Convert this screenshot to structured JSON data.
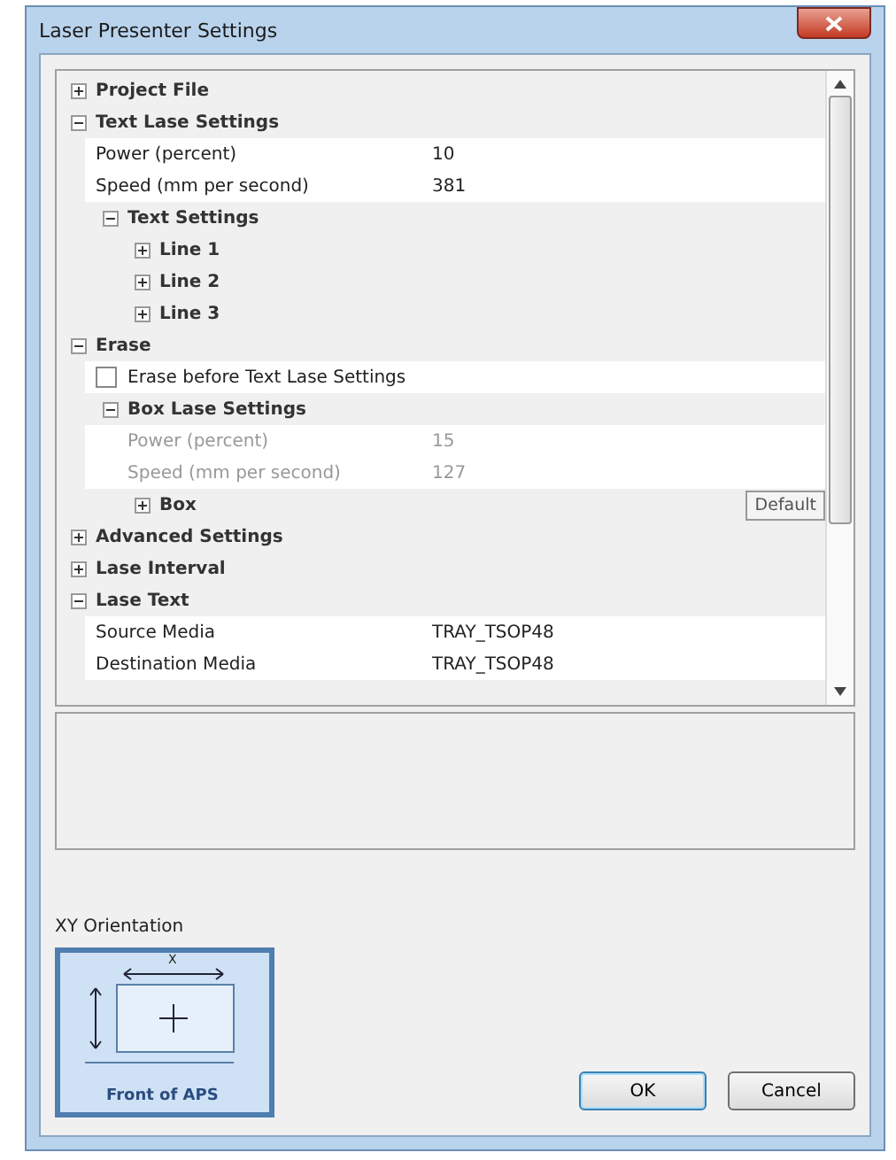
{
  "window": {
    "title": "Laser Presenter Settings"
  },
  "property_grid": {
    "items": [
      {
        "kind": "category",
        "label": "Project File",
        "expanded": false
      },
      {
        "kind": "category",
        "label": "Text Lase Settings",
        "expanded": true,
        "children": [
          {
            "kind": "property",
            "label": "Power (percent)",
            "value": "10",
            "disabled": false
          },
          {
            "kind": "property",
            "label": "Speed (mm per second)",
            "value": "381",
            "disabled": false
          },
          {
            "kind": "category",
            "label": "Text Settings",
            "expanded": true,
            "children": [
              {
                "kind": "category",
                "label": "Line 1",
                "expanded": false
              },
              {
                "kind": "category",
                "label": "Line 2",
                "expanded": false
              },
              {
                "kind": "category",
                "label": "Line 3",
                "expanded": false
              }
            ]
          }
        ]
      },
      {
        "kind": "category",
        "label": "Erase",
        "expanded": true,
        "children": [
          {
            "kind": "checkbox",
            "label": "Erase before Text Lase Settings",
            "checked": false
          },
          {
            "kind": "category",
            "label": "Box Lase Settings",
            "expanded": true,
            "children": [
              {
                "kind": "property",
                "label": "Power (percent)",
                "value": "15",
                "disabled": true
              },
              {
                "kind": "property",
                "label": "Speed (mm per second)",
                "value": "127",
                "disabled": true
              },
              {
                "kind": "category",
                "label": "Box",
                "expanded": false,
                "button": "Default"
              }
            ]
          }
        ]
      },
      {
        "kind": "category",
        "label": "Advanced Settings",
        "expanded": false
      },
      {
        "kind": "category",
        "label": "Lase Interval",
        "expanded": false
      },
      {
        "kind": "category",
        "label": "Lase Text",
        "expanded": true,
        "children": [
          {
            "kind": "property",
            "label": "Source Media",
            "value": "TRAY_TSOP48",
            "disabled": false
          },
          {
            "kind": "property",
            "label": "Destination Media",
            "value": "TRAY_TSOP48",
            "disabled": false
          }
        ]
      }
    ]
  },
  "orientation": {
    "label": "XY Orientation",
    "x_label": "X",
    "front_label": "Front of APS"
  },
  "buttons": [
    "OK",
    "Cancel"
  ]
}
